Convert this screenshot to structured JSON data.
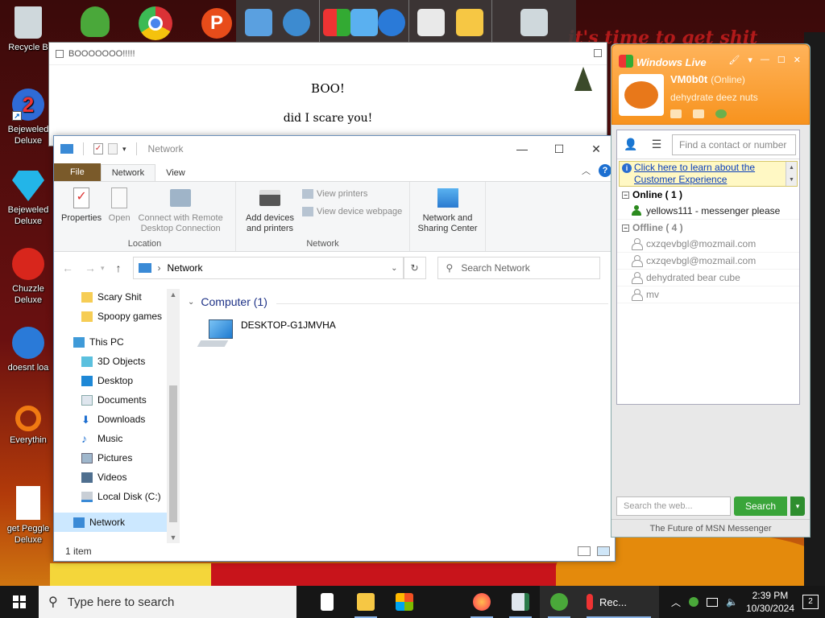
{
  "desktop": {
    "wallpaper_text": "it's time to get shit",
    "icons": [
      {
        "label": "Recycle B",
        "icon": "recycle-bin-icon",
        "color": "#cfd8dc"
      },
      {
        "label": "Bejeweled Deluxe",
        "icon": "bejeweled-2-icon",
        "color": "#2f6bd6"
      },
      {
        "label": "Bejeweled Deluxe",
        "icon": "bejeweled-gem-icon",
        "color": "#23b5e8"
      },
      {
        "label": "Chuzzle Deluxe",
        "icon": "chuzzle-icon",
        "color": "#d8261c"
      },
      {
        "label": "doesnt loa",
        "icon": "thunderbird-icon",
        "color": "#2a7ad8"
      },
      {
        "label": "Everythin",
        "icon": "everything-search-icon",
        "color": "#f07a12"
      },
      {
        "label": "get Peggle Deluxe",
        "icon": "document-icon",
        "color": "#ffffff"
      }
    ]
  },
  "boo_window": {
    "title": "BOOOOOOO!!!!!",
    "line1": "BOO!",
    "line2": "did I scare you!"
  },
  "explorer": {
    "title": "Network",
    "tabs": [
      "File",
      "Network",
      "View"
    ],
    "active_tab": "Network",
    "ribbon": {
      "location_group": "Location",
      "network_group": "Network",
      "properties": "Properties",
      "open": "Open",
      "connect_remote": "Connect with Remote Desktop Connection",
      "add_devices": "Add devices and printers",
      "view_printers": "View printers",
      "view_device_webpage": "View device webpage",
      "network_sharing": "Network and Sharing Center"
    },
    "address": "Network",
    "search_placeholder": "Search Network",
    "nav": [
      {
        "label": "Scary Shit",
        "icon": "folder-icon",
        "level": 1
      },
      {
        "label": "Spoopy games",
        "icon": "folder-icon",
        "level": 1
      },
      {
        "label": "This PC",
        "icon": "this-pc-icon",
        "level": 0
      },
      {
        "label": "3D Objects",
        "icon": "3d-objects-icon",
        "level": 1
      },
      {
        "label": "Desktop",
        "icon": "desktop-folder-icon",
        "level": 1
      },
      {
        "label": "Documents",
        "icon": "documents-icon",
        "level": 1
      },
      {
        "label": "Downloads",
        "icon": "downloads-icon",
        "level": 1
      },
      {
        "label": "Music",
        "icon": "music-icon",
        "level": 1
      },
      {
        "label": "Pictures",
        "icon": "pictures-icon",
        "level": 1
      },
      {
        "label": "Videos",
        "icon": "videos-icon",
        "level": 1
      },
      {
        "label": "Local Disk (C:)",
        "icon": "local-disk-icon",
        "level": 1
      },
      {
        "label": "Network",
        "icon": "network-icon",
        "level": 0,
        "selected": true
      }
    ],
    "group_header": "Computer (1)",
    "computer_name": "DESKTOP-G1JMVHA",
    "status": "1 item"
  },
  "messenger": {
    "brand": "Windows Live",
    "display_name": "VM0b0t",
    "presence": "(Online)",
    "personal_message": "dehydrate deez nuts",
    "find_placeholder": "Find a contact or number",
    "info_link": "Click here to learn about the Customer Experience",
    "online_group": "Online ( 1 )",
    "offline_group": "Offline ( 4 )",
    "online_contacts": [
      "yellows111 - messenger please"
    ],
    "offline_contacts": [
      "cxzqevbgl@mozmail.com",
      "cxzqevbgl@mozmail.com",
      "dehydrated bear cube",
      "mv"
    ],
    "web_placeholder": "Search the web...",
    "search_button": "Search",
    "footer": "The Future of MSN Messenger"
  },
  "taskbar": {
    "search_placeholder": "Type here to search",
    "running_label": "Rec...",
    "time": "2:39 PM",
    "date": "10/30/2024",
    "notification_count": "2"
  },
  "colors": {
    "accent": "#1c6fd1",
    "msn_orange": "#f7931e",
    "file_tab": "#7a5a2a",
    "selection": "#cce8ff"
  }
}
